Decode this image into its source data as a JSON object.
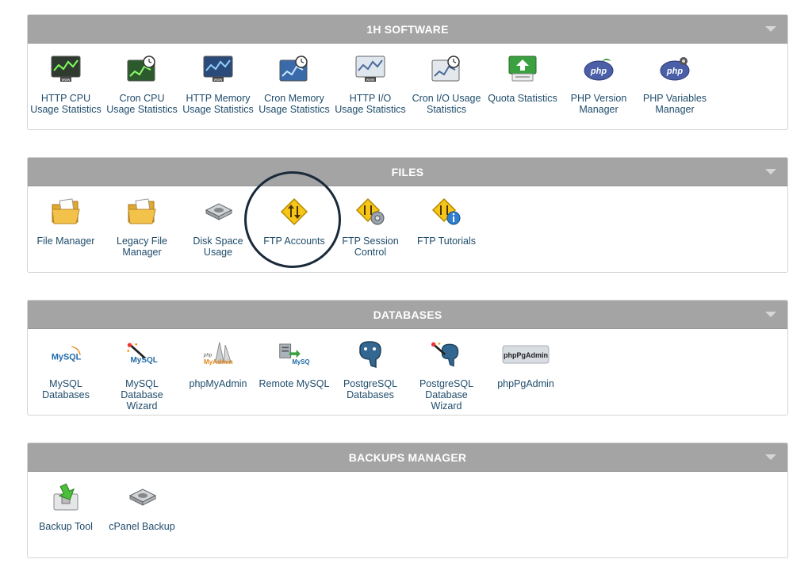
{
  "colors": {
    "header_bg": "#a4a4a4",
    "label_text": "#1f4c6b",
    "highlight": "#1a2a3a"
  },
  "panels": [
    {
      "title": "1H SOFTWARE",
      "items": [
        {
          "label": "HTTP CPU Usage Statistics",
          "icon": "chart-www-icon"
        },
        {
          "label": "Cron CPU Usage Statistics",
          "icon": "chart-clock-icon"
        },
        {
          "label": "HTTP Memory Usage Statistics",
          "icon": "chart-www-icon"
        },
        {
          "label": "Cron Memory Usage Statistics",
          "icon": "chart-clock-icon"
        },
        {
          "label": "HTTP I/O Usage Statistics",
          "icon": "chart-www-icon"
        },
        {
          "label": "Cron I/O Usage Statistics",
          "icon": "chart-clock-icon"
        },
        {
          "label": "Quota Statistics",
          "icon": "quota-icon"
        },
        {
          "label": "PHP Version Manager",
          "icon": "php-icon",
          "badge": "php"
        },
        {
          "label": "PHP Variables Manager",
          "icon": "php-icon",
          "badge": "php"
        }
      ]
    },
    {
      "title": "FILES",
      "items": [
        {
          "label": "File Manager",
          "icon": "folder-icon"
        },
        {
          "label": "Legacy File Manager",
          "icon": "folder-icon"
        },
        {
          "label": "Disk Space Usage",
          "icon": "disk-icon"
        },
        {
          "label": "FTP Accounts",
          "icon": "ftp-accounts-icon"
        },
        {
          "label": "FTP Session Control",
          "icon": "ftp-session-icon"
        },
        {
          "label": "FTP Tutorials",
          "icon": "ftp-tutorials-icon"
        }
      ]
    },
    {
      "title": "DATABASES",
      "items": [
        {
          "label": "MySQL Databases",
          "icon": "mysql-icon",
          "badge": "MySQL"
        },
        {
          "label": "MySQL Database Wizard",
          "icon": "mysql-wizard-icon",
          "badge": "MySQL"
        },
        {
          "label": "phpMyAdmin",
          "icon": "phpmyadmin-icon",
          "badge": "MyAdmin"
        },
        {
          "label": "Remote MySQL",
          "icon": "remote-mysql-icon",
          "badge": "MySQL"
        },
        {
          "label": "PostgreSQL Databases",
          "icon": "postgresql-icon"
        },
        {
          "label": "PostgreSQL Database Wizard",
          "icon": "postgresql-wizard-icon"
        },
        {
          "label": "phpPgAdmin",
          "icon": "phppgadmin-icon",
          "badge": "phpPgAdmin"
        }
      ]
    },
    {
      "title": "BACKUPS MANAGER",
      "items": [
        {
          "label": "Backup Tool",
          "icon": "backup-tool-icon"
        },
        {
          "label": "cPanel Backup",
          "icon": "cpanel-backup-icon"
        }
      ]
    }
  ]
}
